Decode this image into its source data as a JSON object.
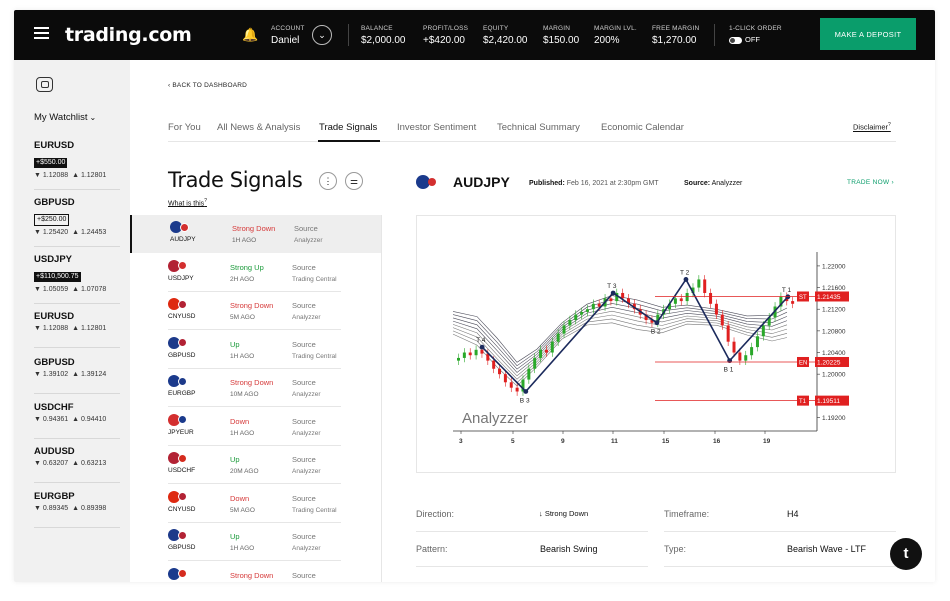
{
  "header": {
    "logo": "trading.com",
    "account_label": "ACCOUNT",
    "account_name": "Daniel",
    "stats": [
      {
        "label": "BALANCE",
        "value": "$2,000.00"
      },
      {
        "label": "PROFIT/LOSS",
        "value": "+$420.00"
      },
      {
        "label": "EQUITY",
        "value": "$2,420.00"
      },
      {
        "label": "MARGIN",
        "value": "$150.00"
      },
      {
        "label": "MARGIN LVL.",
        "value": "200%"
      },
      {
        "label": "FREE MARGIN",
        "value": "$1,270.00"
      }
    ],
    "one_click_label": "1-CLICK ORDER",
    "one_click_value": "OFF",
    "deposit_label": "MAKE A DEPOSIT"
  },
  "watchlist": {
    "title": "My Watchlist",
    "items": [
      {
        "symbol": "EURUSD",
        "badge": "+$550.00",
        "badge_style": "dark",
        "down": "▼ 1.12088",
        "up": "▲ 1.12801"
      },
      {
        "symbol": "GBPUSD",
        "badge": "+$250.00",
        "badge_style": "outline",
        "down": "▼ 1.25420",
        "up": "▲ 1.24453"
      },
      {
        "symbol": "USDJPY",
        "badge": "+$110,500.75",
        "badge_style": "dark",
        "down": "▼ 1.05059",
        "up": "▲ 1.07078"
      },
      {
        "symbol": "EURUSD",
        "badge": "",
        "down": "▼ 1.12088",
        "up": "▲ 1.12801"
      },
      {
        "symbol": "GBPUSD",
        "badge": "",
        "down": "▼ 1.39102",
        "up": "▲ 1.39124"
      },
      {
        "symbol": "USDCHF",
        "badge": "",
        "down": "▼ 0.94361",
        "up": "▲ 0.94410"
      },
      {
        "symbol": "AUDUSD",
        "badge": "",
        "down": "▼ 0.63207",
        "up": "▲ 0.63213"
      },
      {
        "symbol": "EURGBP",
        "badge": "",
        "down": "▼ 0.89345",
        "up": "▲ 0.89398"
      }
    ]
  },
  "nav": {
    "back": "‹ BACK TO DASHBOARD",
    "tabs": [
      "For You",
      "All News & Analysis",
      "Trade Signals",
      "Investor Sentiment",
      "Technical Summary",
      "Economic Calendar"
    ],
    "active_tab": "Trade Signals",
    "disclaimer": "Disclaimer"
  },
  "signals": {
    "title": "Trade Signals",
    "what_is_this": "What is this",
    "source_label": "Source",
    "items": [
      {
        "pair": "AUDJPY",
        "direction": "Strong Down",
        "tone": "red",
        "ago": "1H AGO",
        "source": "Analyzzer",
        "f1": "#1b3a8c",
        "f2": "#d32f2f",
        "selected": true
      },
      {
        "pair": "USDJPY",
        "direction": "Strong Up",
        "tone": "green",
        "ago": "2H AGO",
        "source": "Trading Central",
        "f1": "#b22234",
        "f2": "#d32f2f"
      },
      {
        "pair": "CNYUSD",
        "direction": "Strong Down",
        "tone": "red",
        "ago": "5M AGO",
        "source": "Analyzzer",
        "f1": "#de2910",
        "f2": "#b22234"
      },
      {
        "pair": "GBPUSD",
        "direction": "Up",
        "tone": "green",
        "ago": "1H AGO",
        "source": "Trading Central",
        "f1": "#1d3a8a",
        "f2": "#b22234"
      },
      {
        "pair": "EURGBP",
        "direction": "Strong Down",
        "tone": "red",
        "ago": "10M AGO",
        "source": "Analyzzer",
        "f1": "#1b3a8c",
        "f2": "#1d3a8a"
      },
      {
        "pair": "JPYEUR",
        "direction": "Down",
        "tone": "red",
        "ago": "1H AGO",
        "source": "Analyzzer",
        "f1": "#d32f2f",
        "f2": "#1b3a8c"
      },
      {
        "pair": "USDCHF",
        "direction": "Up",
        "tone": "green",
        "ago": "20M AGO",
        "source": "Analyzzer",
        "f1": "#b22234",
        "f2": "#d52b1e"
      },
      {
        "pair": "CNYUSD",
        "direction": "Down",
        "tone": "red",
        "ago": "5M AGO",
        "source": "Trading Central",
        "f1": "#de2910",
        "f2": "#b22234"
      },
      {
        "pair": "GBPUSD",
        "direction": "Up",
        "tone": "green",
        "ago": "1H AGO",
        "source": "Analyzzer",
        "f1": "#1d3a8a",
        "f2": "#b22234"
      },
      {
        "pair": "EURUSD",
        "direction": "Strong Down",
        "tone": "red",
        "ago": "",
        "source": "",
        "f1": "#1b3a8c",
        "f2": "#d52b1e"
      }
    ]
  },
  "detail": {
    "symbol": "AUDJPY",
    "published_label": "Published:",
    "published_value": "Feb 16, 2021 at 2:30pm GMT",
    "source_label": "Source:",
    "source_value": "Analyzzer",
    "trade_now": "TRADE NOW ›",
    "rows": [
      {
        "label": "Direction:",
        "value": "↓ Strong Down",
        "label2": "Timeframe:",
        "value2": "H4"
      },
      {
        "label": "Pattern:",
        "value": "Bearish Swing",
        "label2": "Type:",
        "value2": "Bearish Wave - LTF"
      }
    ]
  },
  "colors": {
    "accent": "#0a9d6b",
    "down": "#d63a3a",
    "up": "#1a9a3a"
  },
  "chart_data": {
    "type": "candlestick",
    "watermark": "Analyzzer",
    "x_ticks": [
      "3",
      "5",
      "9",
      "11",
      "15",
      "16",
      "19"
    ],
    "y_ticks": [
      "1.22000",
      "1.21600",
      "1.21200",
      "1.20800",
      "1.20400",
      "1.20000",
      "1.19200"
    ],
    "ylim": [
      1.1895,
      1.2222
    ],
    "levels": [
      {
        "name": "ST",
        "value": "1.21435"
      },
      {
        "name": "EN",
        "value": "1.20225"
      },
      {
        "name": "T1",
        "value": "1.19511"
      }
    ],
    "points": [
      {
        "name": "T 4",
        "t": 2.0,
        "v": 1.205
      },
      {
        "name": "B 3",
        "t": 5.0,
        "v": 1.1968
      },
      {
        "name": "T 3",
        "t": 11.0,
        "v": 1.215
      },
      {
        "name": "B 2",
        "t": 14.0,
        "v": 1.2095
      },
      {
        "name": "T 2",
        "t": 16.0,
        "v": 1.2175
      },
      {
        "name": "B 1",
        "t": 19.0,
        "v": 1.2025
      },
      {
        "name": "T 1",
        "t": 23.0,
        "v": 1.2143
      }
    ]
  }
}
